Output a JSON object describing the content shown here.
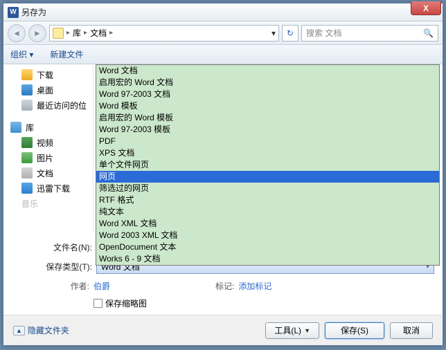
{
  "titlebar": {
    "title": "另存为",
    "close_symbol": "X"
  },
  "nav": {
    "back": "◄",
    "forward": "►",
    "breadcrumb": {
      "root": "库",
      "sep": "▸",
      "item": "文档"
    },
    "dropdown_arrow": "▾",
    "refresh": "↻",
    "search_placeholder": "搜索 文档",
    "search_icon": "🔍"
  },
  "toolbar": {
    "organize": "组织 ▾",
    "newfolder": "新建文件"
  },
  "sidebar": {
    "downloads": "下载",
    "desktop": "桌面",
    "recent": "最近访问的位",
    "library": "库",
    "video": "视频",
    "pictures": "图片",
    "documents": "文档",
    "xunlei": "迅雷下载",
    "music": "音乐"
  },
  "dropdown": {
    "items": [
      "Word 文档",
      "启用宏的 Word 文档",
      "Word 97-2003 文档",
      "Word 模板",
      "启用宏的 Word 模板",
      "Word 97-2003 模板",
      "PDF",
      "XPS 文档",
      "单个文件网页",
      "网页",
      "筛选过的网页",
      "RTF 格式",
      "纯文本",
      "Word XML 文档",
      "Word 2003 XML 文档",
      "OpenDocument 文本",
      "Works 6 - 9 文档"
    ],
    "selected_index": 9
  },
  "form": {
    "filename_label": "文件名(N):",
    "savetype_label": "保存类型(T):",
    "savetype_value": "Word 文档",
    "arrow": "▾"
  },
  "meta": {
    "author_label": "作者:",
    "author_value": "伯爵",
    "tags_label": "标记:",
    "tags_value": "添加标记",
    "thumb_label": "保存缩略图"
  },
  "footer": {
    "hide": "隐藏文件夹",
    "expand_icon": "▲",
    "tools": "工具(L)",
    "save": "保存(S)",
    "cancel": "取消"
  }
}
